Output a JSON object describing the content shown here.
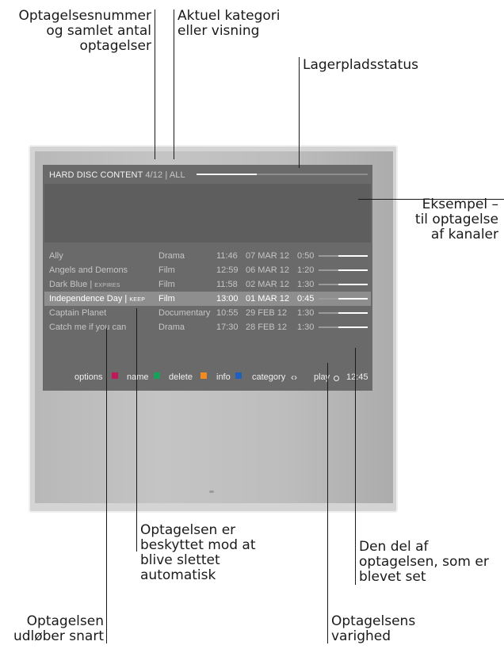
{
  "callouts": {
    "record_number": [
      "Optagelsesnummer",
      "og samlet antal",
      "optagelser"
    ],
    "current_category": [
      "Aktuel kategori",
      "eller visning"
    ],
    "storage_status": [
      "Lagerpladsstatus"
    ],
    "preview": [
      "Eksempel –",
      "til optagelse",
      "af kanaler"
    ],
    "protected": [
      "Optagelsen er",
      "beskyttet mod at",
      "blive slettet",
      "automatisk"
    ],
    "watched_part": [
      "Den del af",
      "optagelsen, som er",
      "blevet set"
    ],
    "expires_soon": [
      "Optagelsen",
      "udløber snart"
    ],
    "duration": [
      "Optagelsens",
      "varighed"
    ]
  },
  "screen": {
    "header_title": "HARD DISC CONTENT",
    "header_counter": "4/12 | ALL",
    "storage_used_fraction": 0.35
  },
  "recordings": [
    {
      "title": "Ally",
      "tag": "",
      "category": "Drama",
      "time": "11:46",
      "date": "07 MAR 12",
      "duration": "0:50",
      "watched": 0.6,
      "selected": false
    },
    {
      "title": "Angels and Demons",
      "tag": "",
      "category": "Film",
      "time": "12:59",
      "date": "06 MAR 12",
      "duration": "1:20",
      "watched": 0.6,
      "selected": false
    },
    {
      "title": "Dark Blue | ",
      "tag": "EXPIRES",
      "category": "Film",
      "time": "11:58",
      "date": "02 MAR 12",
      "duration": "1:30",
      "watched": 0.6,
      "selected": false
    },
    {
      "title": "Independence Day | ",
      "tag": "KEEP",
      "category": "Film",
      "time": "13:00",
      "date": "01 MAR 12",
      "duration": "0:45",
      "watched": 0.6,
      "selected": true
    },
    {
      "title": "Captain Planet",
      "tag": "",
      "category": "Documentary",
      "time": "10:55",
      "date": "29 FEB 12",
      "duration": "1:30",
      "watched": 0.6,
      "selected": false
    },
    {
      "title": "Catch me if you can",
      "tag": "",
      "category": "Drama",
      "time": "17:30",
      "date": "28 FEB 12",
      "duration": "1:30",
      "watched": 0.6,
      "selected": false
    }
  ],
  "footer": {
    "options": "options",
    "name": "name",
    "delete": "delete",
    "info": "info",
    "category": "category",
    "category_symbol": "‹›",
    "play": "play",
    "clock": "12:45"
  },
  "colors": {
    "red": "#c2185b",
    "green": "#1aa05a",
    "yellow": "#f28a1e",
    "blue": "#1f5fbf"
  }
}
